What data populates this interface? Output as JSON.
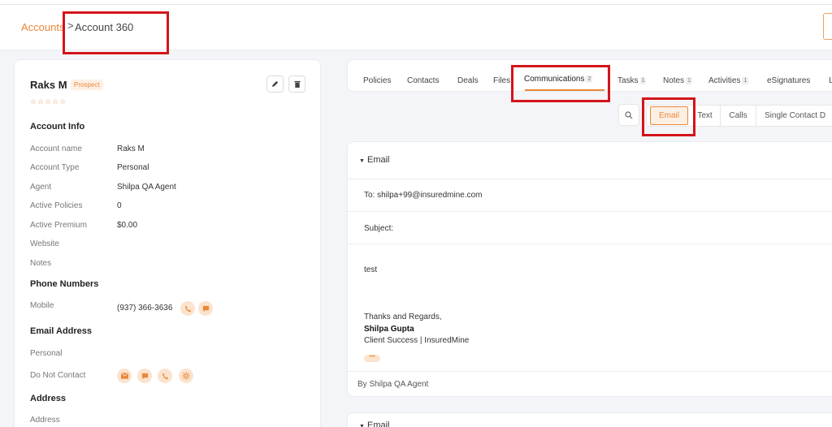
{
  "breadcrumb": {
    "parent": "Accounts",
    "separator": ">",
    "current": "Account 360"
  },
  "account": {
    "name": "Raks M",
    "status_badge": "Prospect",
    "rating": "☆☆☆☆☆",
    "sections": {
      "info": "Account Info",
      "phones": "Phone Numbers",
      "email": "Email Address",
      "address": "Address"
    },
    "fields": [
      {
        "label": "Account name",
        "value": "Raks M"
      },
      {
        "label": "Account Type",
        "value": "Personal"
      },
      {
        "label": "Agent",
        "value": "Shilpa QA Agent"
      },
      {
        "label": "Active Policies",
        "value": "0"
      },
      {
        "label": "Active Premium",
        "value": "$0.00"
      },
      {
        "label": "Website",
        "value": ""
      },
      {
        "label": "Notes",
        "value": ""
      }
    ],
    "phone": {
      "label": "Mobile",
      "value": "(937) 366-3636"
    },
    "email_rows": [
      {
        "label": "Personal"
      },
      {
        "label": "Do Not Contact"
      }
    ],
    "address_label": "Address"
  },
  "tabs": [
    {
      "label": "Policies",
      "count": ""
    },
    {
      "label": "Contacts",
      "count": ""
    },
    {
      "label": "Deals",
      "count": ""
    },
    {
      "label": "Files",
      "count": ""
    },
    {
      "label": "Communications",
      "count": "2"
    },
    {
      "label": "Tasks",
      "count": "1"
    },
    {
      "label": "Notes",
      "count": "1"
    },
    {
      "label": "Activities",
      "count": "1"
    },
    {
      "label": "eSignatures",
      "count": ""
    },
    {
      "label": "L",
      "count": ""
    }
  ],
  "active_tab": "Communications",
  "filters": [
    "Email",
    "Text",
    "Calls",
    "Single Contact D"
  ],
  "active_filter": "Email",
  "emails": [
    {
      "header": "Email",
      "to": "To: shilpa+99@insuredmine.com",
      "subject": "Subject:",
      "body": "test",
      "signoff": "Thanks and Regards,",
      "signature_name": "Shilpa Gupta",
      "signature_title": "Client Success | InsuredMine",
      "more": "•••",
      "by": "By Shilpa QA Agent"
    },
    {
      "header": "Email"
    }
  ],
  "colors": {
    "accent": "#e8883a",
    "highlight": "#d4141b"
  }
}
